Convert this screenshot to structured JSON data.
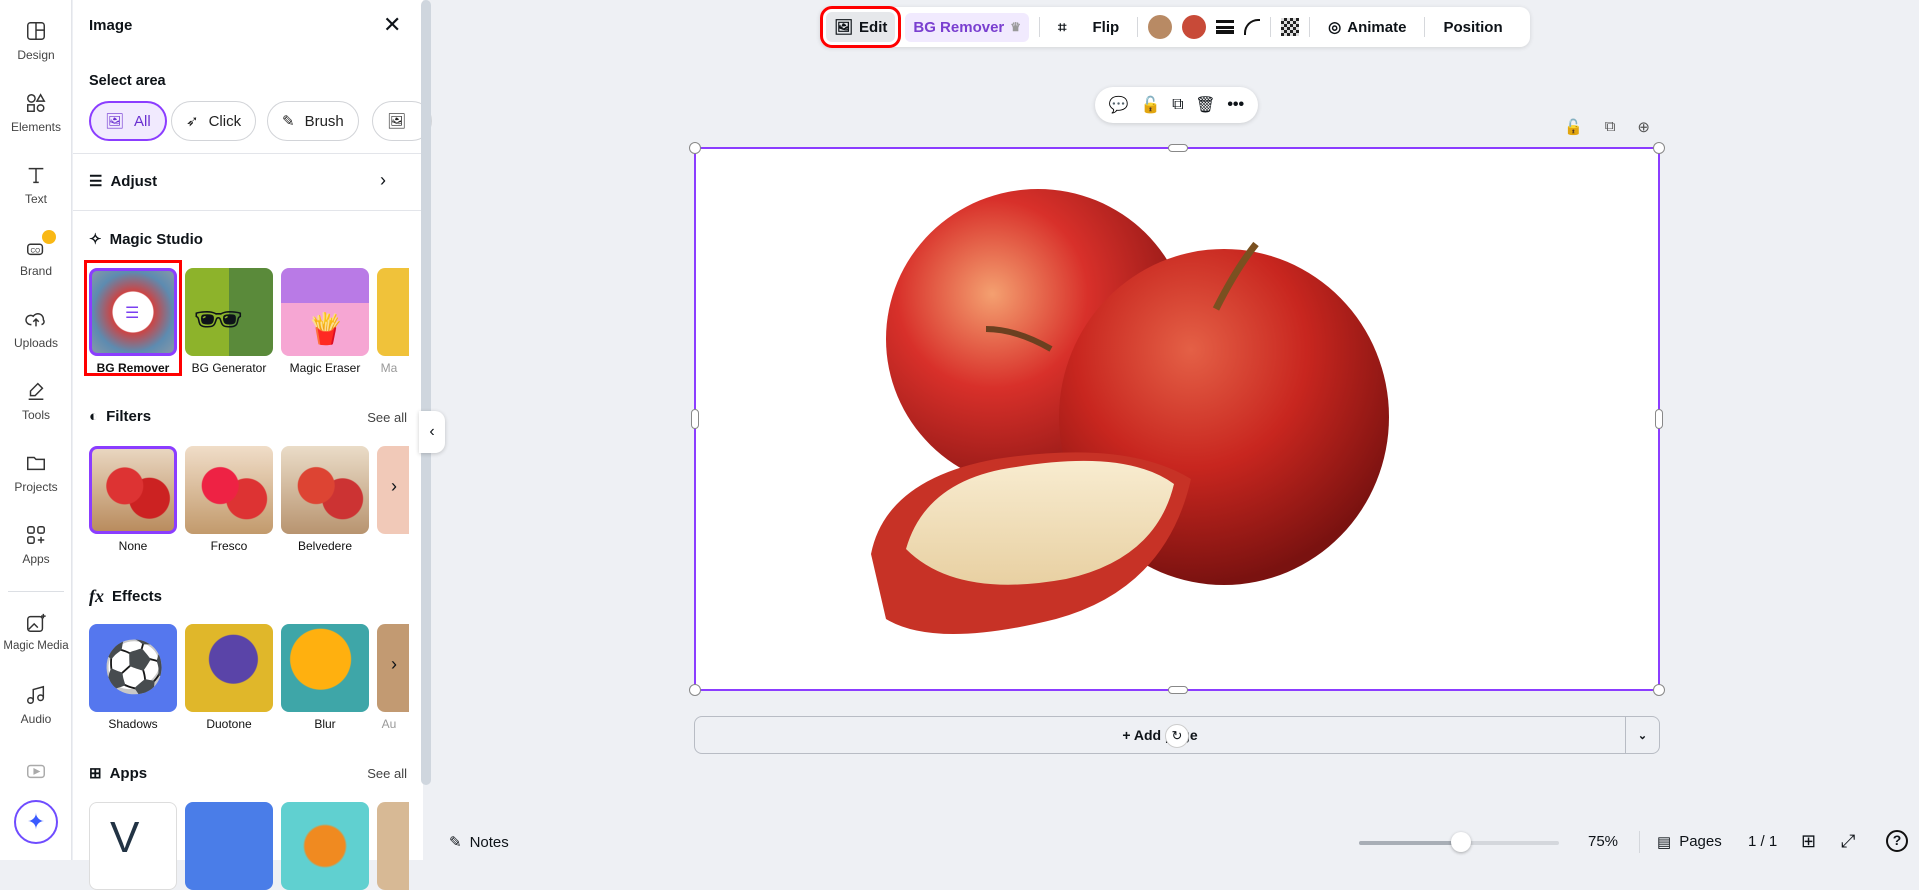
{
  "rail": {
    "items": [
      {
        "label": "Design"
      },
      {
        "label": "Elements"
      },
      {
        "label": "Text"
      },
      {
        "label": "Brand"
      },
      {
        "label": "Uploads"
      },
      {
        "label": "Tools"
      },
      {
        "label": "Projects"
      },
      {
        "label": "Apps"
      },
      {
        "label": "Magic Media"
      },
      {
        "label": "Audio"
      }
    ]
  },
  "panel": {
    "title": "Image",
    "select_area": {
      "heading": "Select area",
      "options": [
        "All",
        "Click",
        "Brush"
      ]
    },
    "adjust": "Adjust",
    "magic_studio": {
      "heading": "Magic Studio",
      "items": [
        "BG Remover",
        "BG Generator",
        "Magic Eraser",
        "Ma"
      ]
    },
    "filters": {
      "heading": "Filters",
      "see_all": "See all",
      "items": [
        "None",
        "Fresco",
        "Belvedere"
      ]
    },
    "effects": {
      "heading": "Effects",
      "icon_text": "fx",
      "items": [
        "Shadows",
        "Duotone",
        "Blur",
        "Au"
      ]
    },
    "apps": {
      "heading": "Apps",
      "see_all": "See all"
    }
  },
  "toolbar": {
    "edit": "Edit",
    "bg_remover": "BG Remover",
    "flip": "Flip",
    "animate": "Animate",
    "position": "Position",
    "colors": [
      "#b88a64",
      "#c84a38"
    ]
  },
  "canvas": {
    "add_page": "+ Add page"
  },
  "bottom": {
    "notes": "Notes",
    "zoom": "75%",
    "zoom_fraction": 0.5,
    "pages": "Pages",
    "page_count": "1 / 1"
  },
  "colors": {
    "accent": "#8b3dff",
    "highlight": "#ff0000"
  }
}
